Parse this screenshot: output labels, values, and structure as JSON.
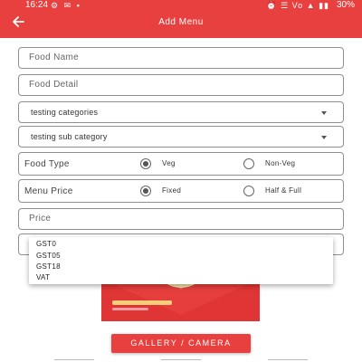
{
  "status_bar": {
    "time": "16:24",
    "left_icons": "⚙ ✉ ▪",
    "right_icons": "⏰ ☰ Vo ▲ ▮▮",
    "battery": "30%"
  },
  "app_bar": {
    "back_icon": "arrow-left-icon",
    "title": "Add Menu"
  },
  "form": {
    "food_name": {
      "placeholder": "Food Name",
      "value": ""
    },
    "food_detail": {
      "placeholder": "Food Detail",
      "value": ""
    },
    "category": {
      "value": "testing categories"
    },
    "sub_category": {
      "value": "testing sub category"
    },
    "food_type": {
      "label": "Food Type",
      "options": [
        {
          "label": "Veg",
          "selected": true
        },
        {
          "label": "Non-Veg",
          "selected": false
        }
      ]
    },
    "menu_price": {
      "label": "Menu Price",
      "options": [
        {
          "label": "Fixed",
          "selected": true
        },
        {
          "label": "Half & Full",
          "selected": false
        }
      ]
    },
    "price": {
      "placeholder": "Price",
      "value": ""
    }
  },
  "tax_dropdown": {
    "options": [
      "GST0",
      "GST05",
      "GST18",
      "VAT"
    ]
  },
  "gallery_button": {
    "label": "GALLERY / CAMERA"
  },
  "colors": {
    "accent": "#e8403f",
    "border": "#8f8f8f"
  }
}
